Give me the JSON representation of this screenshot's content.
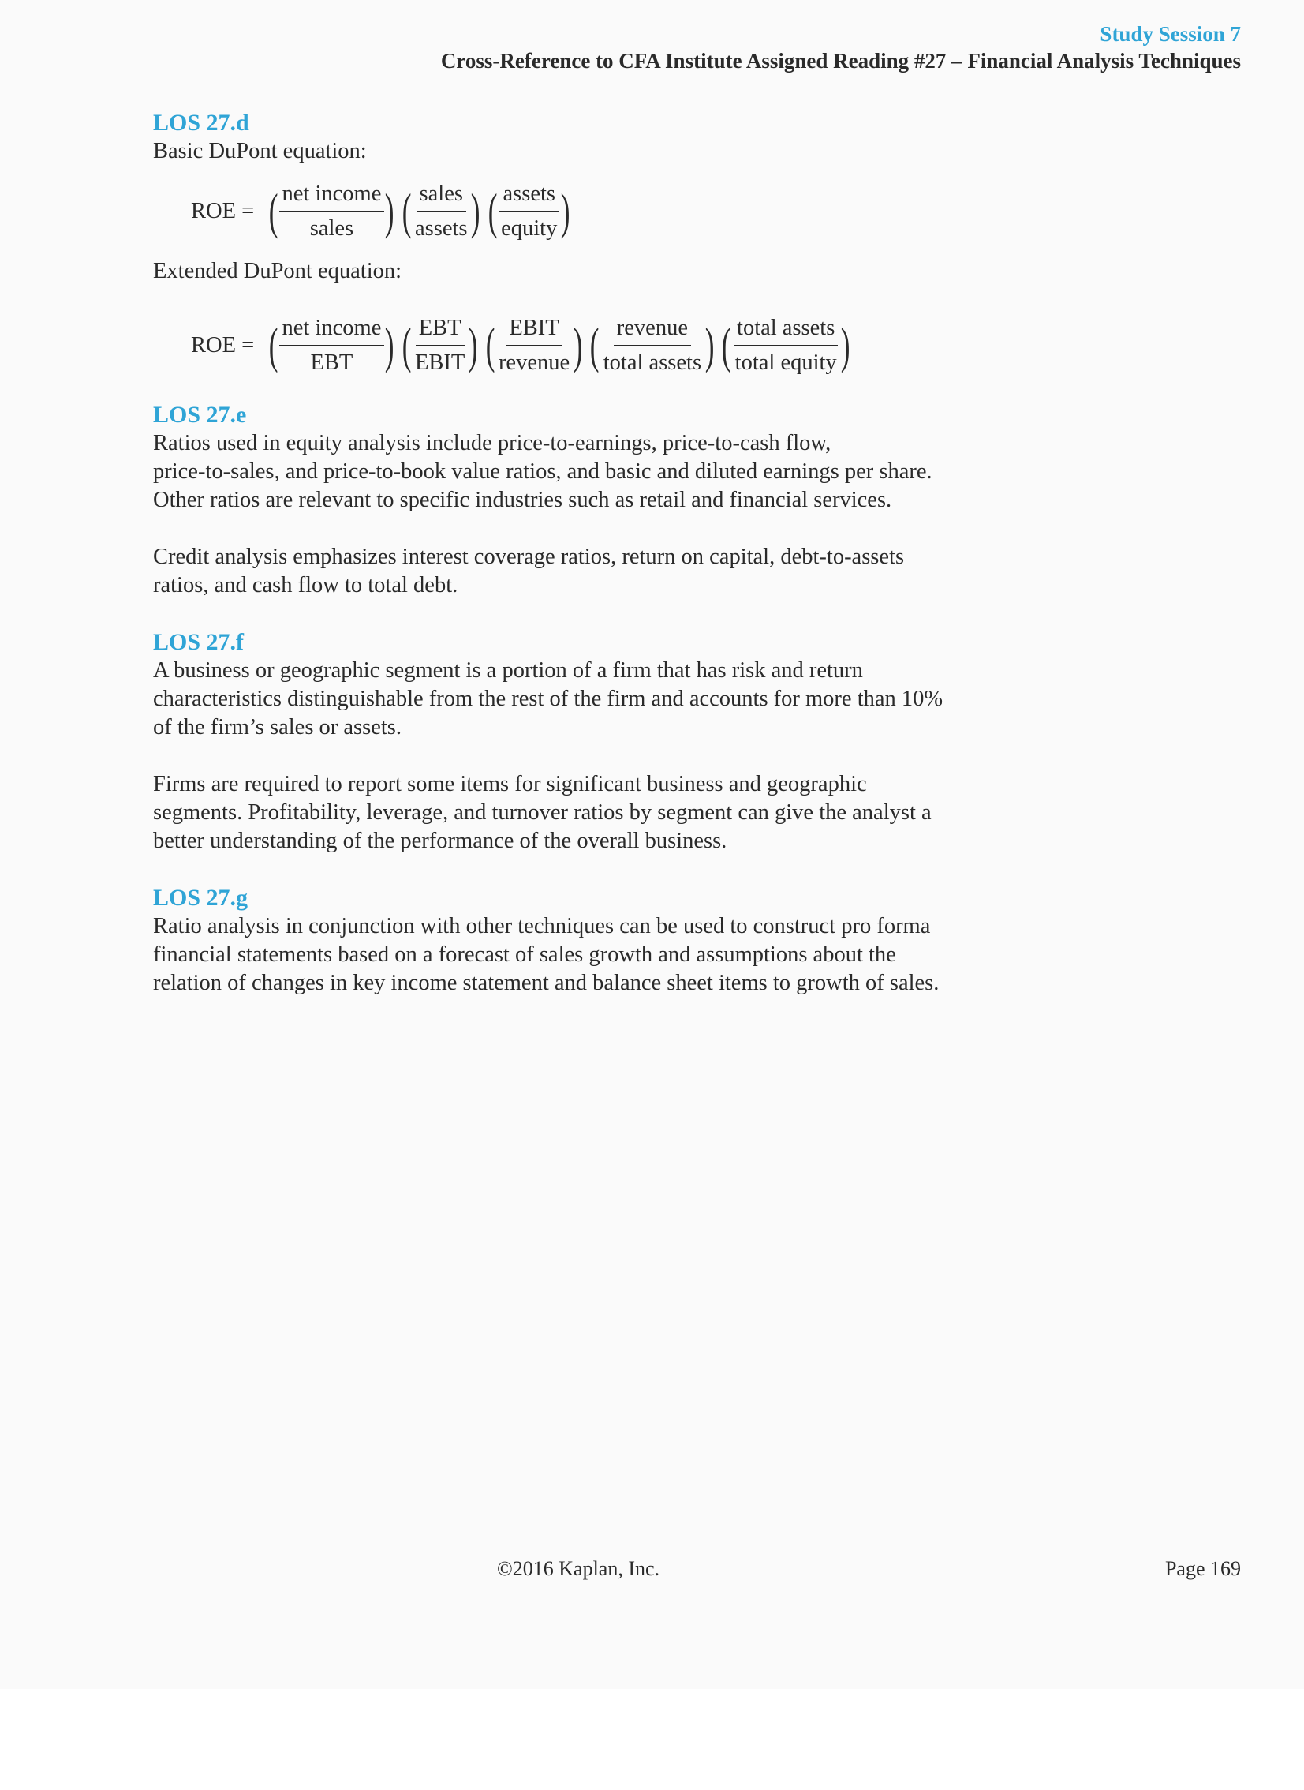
{
  "header": {
    "session": "Study Session 7",
    "reference": "Cross-Reference to CFA Institute Assigned Reading #27 – Financial Analysis Techniques"
  },
  "sections": {
    "d": {
      "heading": "LOS 27.d",
      "basic_intro": "Basic DuPont equation:",
      "basic_label": "ROE =",
      "basic_terms": [
        {
          "num": "net income",
          "den": "sales"
        },
        {
          "num": "sales",
          "den": "assets"
        },
        {
          "num": "assets",
          "den": "equity"
        }
      ],
      "extended_intro": "Extended DuPont equation:",
      "extended_label": "ROE =",
      "extended_terms": [
        {
          "num": "net income",
          "den": "EBT"
        },
        {
          "num": "EBT",
          "den": "EBIT"
        },
        {
          "num": "EBIT",
          "den": "revenue"
        },
        {
          "num": "revenue",
          "den": "total assets"
        },
        {
          "num": "total assets",
          "den": "total equity"
        }
      ]
    },
    "e": {
      "heading": "LOS 27.e",
      "line1": "Ratios used in equity analysis include price-to-earnings, price-to-cash flow,",
      "line2": "price-to-sales, and price-to-book value ratios, and basic and diluted earnings per share.",
      "line3": "Other ratios are relevant to specific industries such as retail and financial services.",
      "line4": "Credit analysis emphasizes interest coverage ratios, return on capital, debt-to-assets",
      "line5": "ratios, and cash flow to total debt."
    },
    "f": {
      "heading": "LOS 27.f",
      "line1": "A business or geographic segment is a portion of a firm that has risk and return",
      "line2": "characteristics distinguishable from the rest of the firm and accounts for more than 10%",
      "line3": "of the firm’s sales or assets.",
      "line4": "Firms are required to report some items for significant business and geographic",
      "line5": "segments. Profitability, leverage, and turnover ratios by segment can give the analyst a",
      "line6": "better understanding of the performance of the overall business."
    },
    "g": {
      "heading": "LOS 27.g",
      "line1": "Ratio analysis in conjunction with other techniques can be used to construct pro forma",
      "line2": "financial statements based on a forecast of sales growth and assumptions about the",
      "line3": "relation of changes in key income statement and balance sheet items to growth of sales."
    }
  },
  "footer": {
    "copyright": "©2016 Kaplan, Inc.",
    "page": "Page 169"
  }
}
